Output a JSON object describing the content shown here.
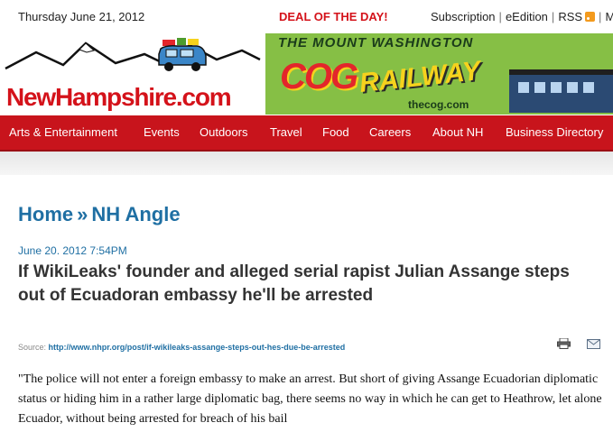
{
  "header": {
    "date": "Thursday June 21, 2012",
    "deal": "DEAL OF THE DAY!",
    "links": [
      "Subscription",
      "eEdition",
      "RSS",
      "M"
    ]
  },
  "logo": {
    "name": "NewHampshire",
    "suffix": ".com"
  },
  "ad": {
    "title": "THE MOUNT WASHINGTON",
    "cog": "COG",
    "railway": "RAILWAY",
    "url": "thecog.com"
  },
  "nav": [
    "Arts & Entertainment",
    "Events",
    "Outdoors",
    "Travel",
    "Food",
    "Careers",
    "About NH",
    "Business Directory"
  ],
  "breadcrumb": {
    "home": "Home",
    "sep": "»",
    "section": "NH Angle"
  },
  "article": {
    "date": "June 20. 2012 7:54PM",
    "headline": "If WikiLeaks' founder and alleged serial rapist Julian Assange steps out of Ecuadoran embassy he'll be arrested",
    "source_label": "Source:",
    "source_url": "http://www.nhpr.org/post/if-wikileaks-assange-steps-out-hes-due-be-arrested",
    "body": "\"The police will not enter a foreign embassy to make an arrest. But short of giving Assange Ecuadorian diplomatic status or hiding him in a rather large diplomatic bag, there seems no way in which he can get to Heathrow, let alone Ecuador, without being arrested for breach of his bail"
  },
  "colors": {
    "brand_red": "#c8141c",
    "link_blue": "#1f6fa3",
    "rss_orange": "#f39a1d"
  },
  "icons": [
    "rss-icon",
    "mountain-logo-icon",
    "car-logo-icon",
    "print-icon",
    "email-icon"
  ]
}
